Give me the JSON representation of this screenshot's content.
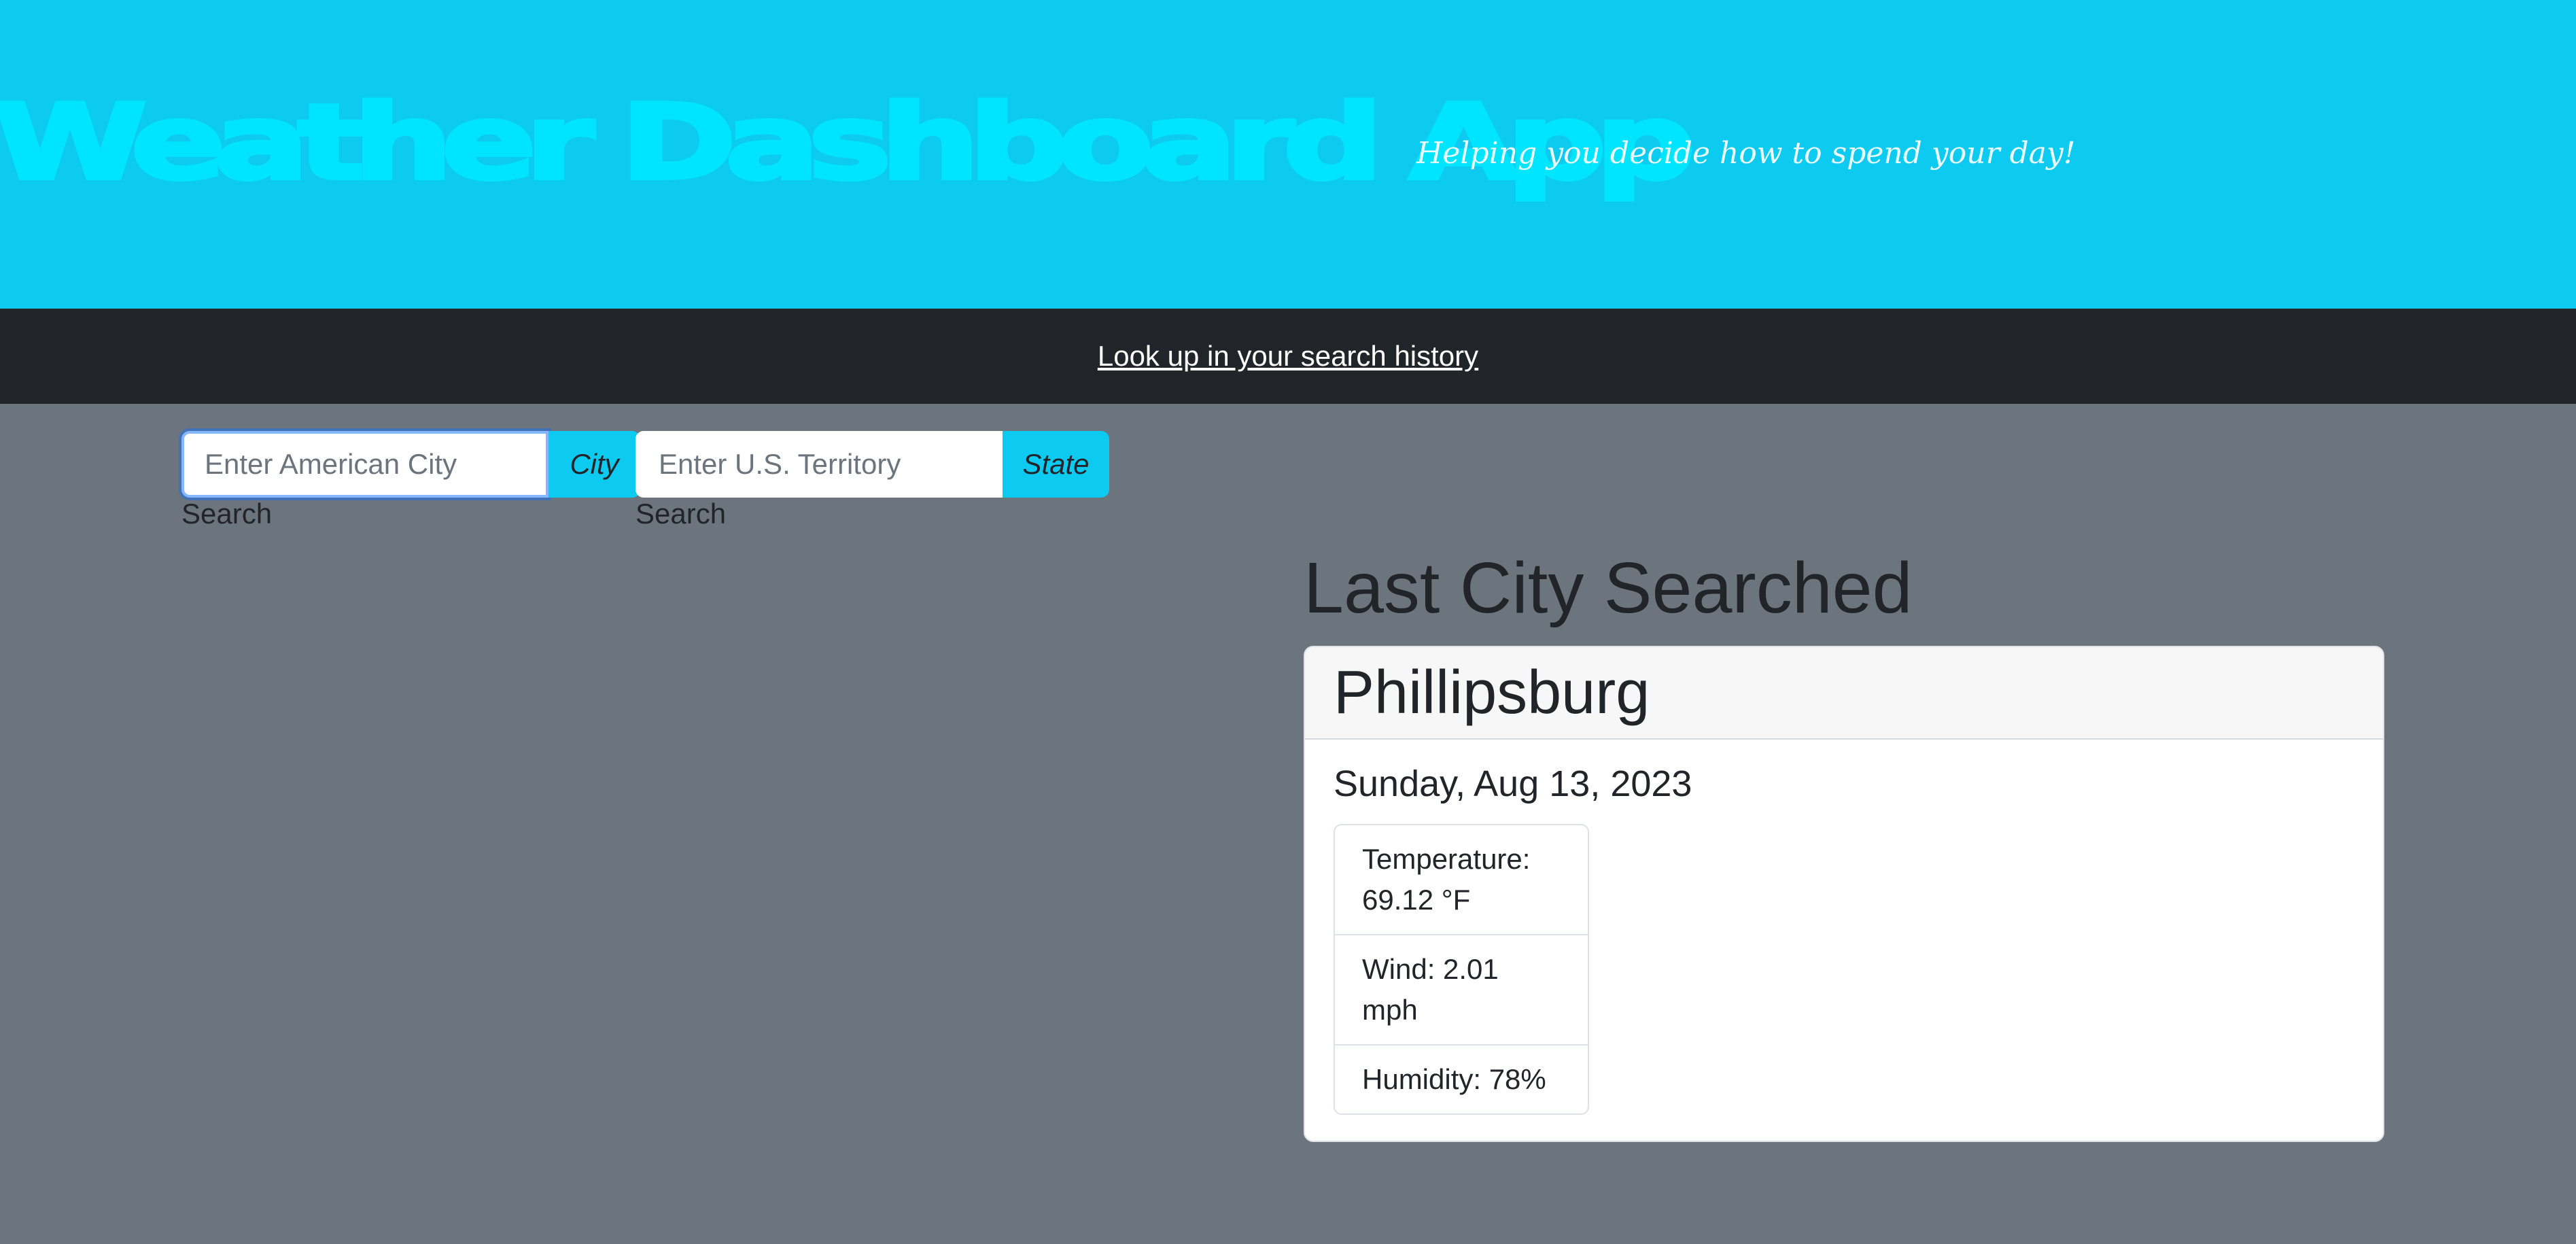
{
  "header": {
    "title": "Weather Dashboard App",
    "tagline": "Helping you decide how to spend your day!"
  },
  "nav": {
    "history_link": "Look up in your search history"
  },
  "search": {
    "city": {
      "placeholder": "Enter American City",
      "button_label": "City",
      "label": "Search"
    },
    "state": {
      "placeholder": "Enter U.S. Territory",
      "button_label": "State",
      "label": "Search"
    }
  },
  "last_city": {
    "heading": "Last City Searched",
    "city": "Phillipsburg",
    "date": "Sunday, Aug 13, 2023",
    "stats": [
      "Temperature: 69.12 °F",
      "Wind: 2.01 mph",
      "Humidity: 78%"
    ]
  },
  "colors": {
    "header_bg": "#0dcaf0",
    "title": "#00e5ff",
    "nav_bg": "#212529",
    "page_bg": "#6c757d",
    "button_bg": "#0dcaf0"
  }
}
